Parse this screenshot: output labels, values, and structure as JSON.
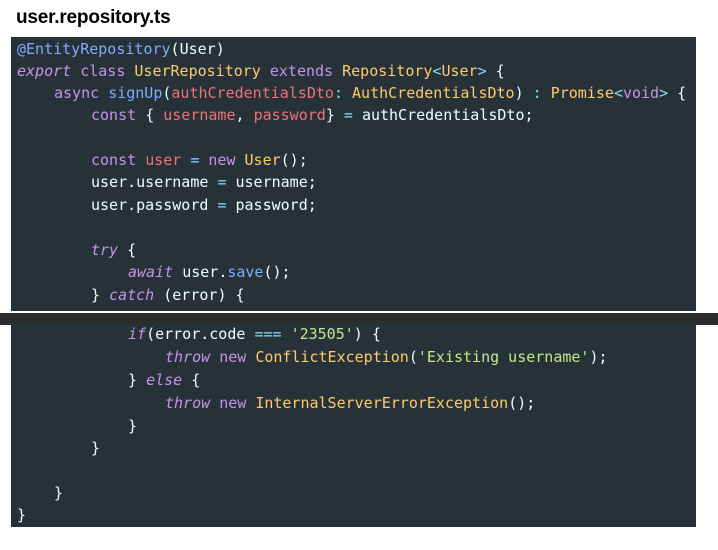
{
  "file_title": "user.repository.ts",
  "code": {
    "decorator": "@EntityRepository",
    "decorator_arg": "User",
    "export_kw": "export",
    "class_kw": "class",
    "class_name": "UserRepository",
    "extends_kw": "extends",
    "base_class": "Repository",
    "base_generic": "User",
    "async_kw": "async",
    "method_name": "signUp",
    "param_name": "authCredentialsDto",
    "param_type": "AuthCredentialsDto",
    "return_type": "Promise",
    "return_generic": "void",
    "const_kw": "const",
    "destruct_username": "username",
    "destruct_password": "password",
    "destruct_source": "authCredentialsDto",
    "user_var": "user",
    "new_kw": "new",
    "user_class": "User",
    "assign_username_target": "user.username",
    "assign_username_value": "username",
    "assign_password_target": "user.password",
    "assign_password_value": "password",
    "try_kw": "try",
    "await_kw": "await",
    "save_obj": "user",
    "save_method": "save",
    "catch_kw": "catch",
    "error_param": "error",
    "if_kw": "if",
    "error_code_expr": "error.code",
    "strict_eq": "===",
    "error_code_value": "'23505'",
    "throw_kw": "throw",
    "conflict_exception": "ConflictException",
    "conflict_message": "'Existing username'",
    "else_kw": "else",
    "internal_exception": "InternalServerErrorException"
  }
}
